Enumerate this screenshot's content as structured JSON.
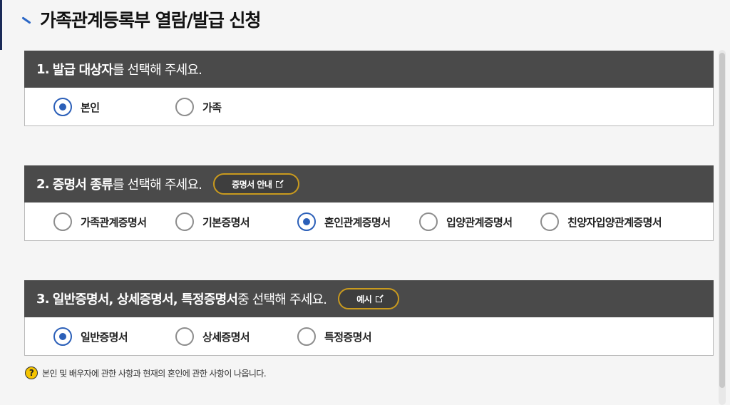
{
  "page": {
    "title": "가족관계등록부 열람/발급 신청"
  },
  "sections": [
    {
      "num": "1.",
      "title_bold": "발급 대상자",
      "title_rest": "를 선택해 주세요.",
      "options": [
        {
          "label": "본인",
          "selected": true
        },
        {
          "label": "가족",
          "selected": false
        }
      ]
    },
    {
      "num": "2.",
      "title_bold": "증명서 종류",
      "title_rest": "를 선택해 주세요.",
      "button": "증명서 안내",
      "options": [
        {
          "label": "가족관계증명서",
          "selected": false
        },
        {
          "label": "기본증명서",
          "selected": false
        },
        {
          "label": "혼인관계증명서",
          "selected": true
        },
        {
          "label": "입양관계증명서",
          "selected": false
        },
        {
          "label": "친양자입양관계증명서",
          "selected": false
        }
      ]
    },
    {
      "num": "3.",
      "title_bold": "일반증명서, 상세증명서, 특정증명서",
      "title_rest": " 중 선택해 주세요.",
      "button": "예시",
      "options": [
        {
          "label": "일반증명서",
          "selected": true
        },
        {
          "label": "상세증명서",
          "selected": false
        },
        {
          "label": "특정증명서",
          "selected": false
        }
      ]
    }
  ],
  "note": {
    "icon": "question-icon",
    "text": "본인 및 배우자에 관한 사항과 현재의 혼인에 관한 사항이 나옵니다."
  },
  "colors": {
    "header_bg": "#4a4a4a",
    "accent": "#2b5fb8",
    "button_border": "#c99a1e"
  }
}
